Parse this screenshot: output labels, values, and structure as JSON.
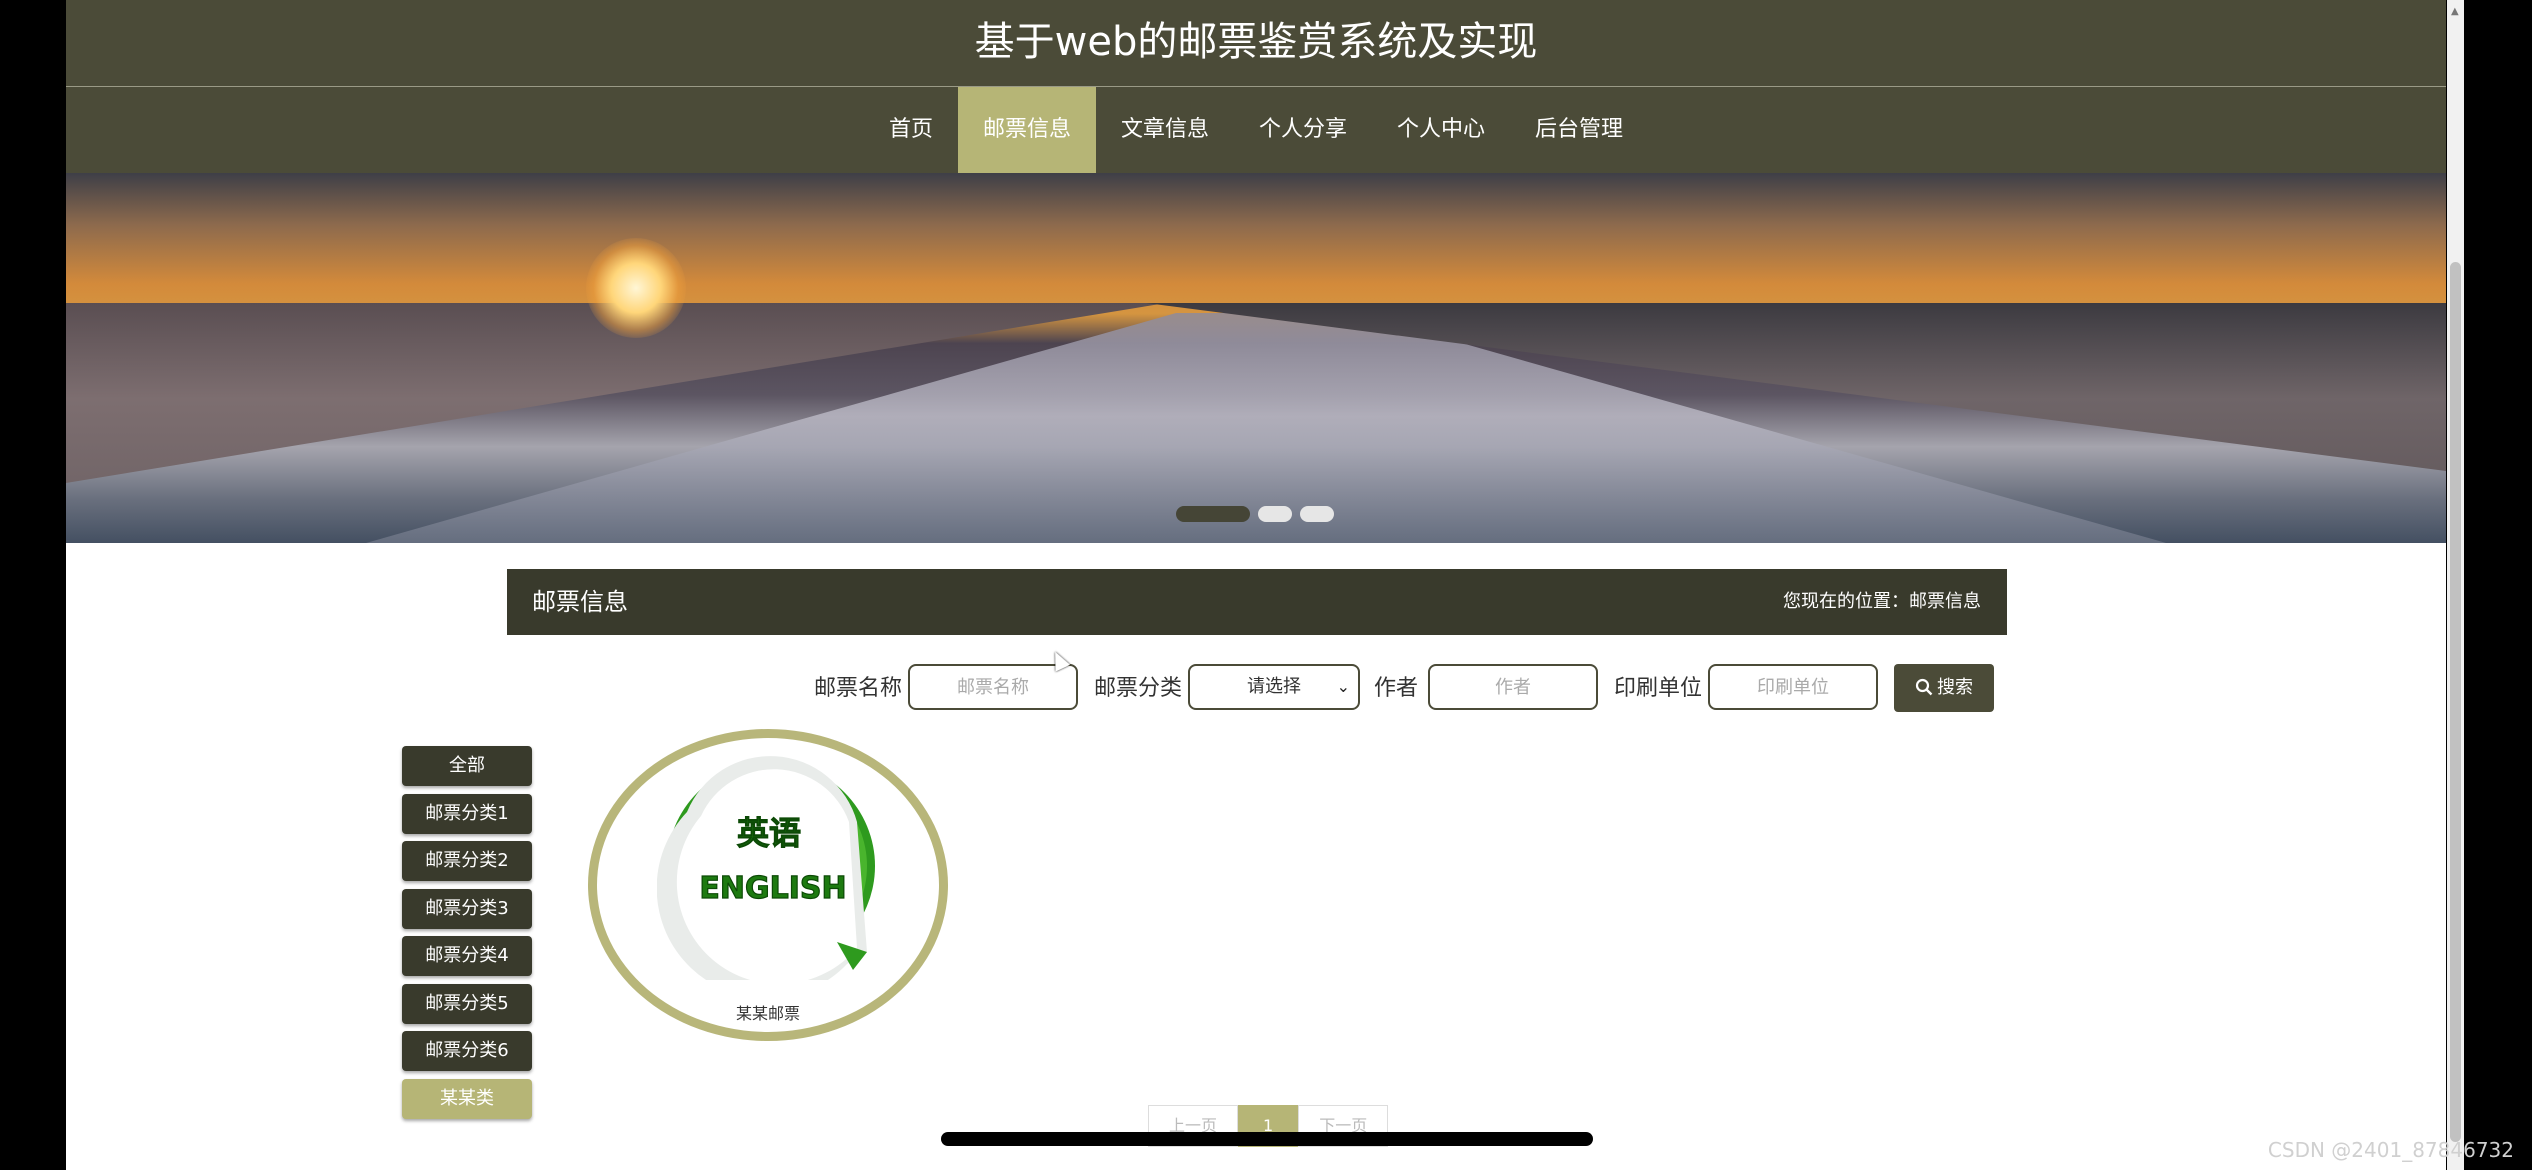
{
  "header": {
    "title": "基于web的邮票鉴赏系统及实现"
  },
  "nav": {
    "items": [
      {
        "label": "首页"
      },
      {
        "label": "邮票信息"
      },
      {
        "label": "文章信息"
      },
      {
        "label": "个人分享"
      },
      {
        "label": "个人中心"
      },
      {
        "label": "后台管理"
      }
    ],
    "active": "邮票信息"
  },
  "banner": {
    "slides": 3,
    "active_slide": 1
  },
  "section": {
    "title": "邮票信息",
    "breadcrumb": "您现在的位置：邮票信息"
  },
  "search": {
    "name_label": "邮票名称",
    "name_placeholder": "邮票名称",
    "category_label": "邮票分类",
    "category_selected": "请选择",
    "author_label": "作者",
    "author_placeholder": "作者",
    "printer_label": "印刷单位",
    "printer_placeholder": "印刷单位",
    "button_label": "搜索"
  },
  "sidebar": {
    "items": [
      {
        "label": "全部"
      },
      {
        "label": "邮票分类1"
      },
      {
        "label": "邮票分类2"
      },
      {
        "label": "邮票分类3"
      },
      {
        "label": "邮票分类4"
      },
      {
        "label": "邮票分类5"
      },
      {
        "label": "邮票分类6"
      },
      {
        "label": "某某类"
      }
    ],
    "active": "某某类"
  },
  "products": [
    {
      "name": "某某邮票",
      "image_text_top": "英语",
      "image_text_bottom": "ENGLISH"
    }
  ],
  "pagination": {
    "prev": "上一页",
    "current": "1",
    "next": "下一页"
  },
  "watermark": "CSDN @2401_87846732",
  "colors": {
    "primary": "#4b4b38",
    "accent": "#b6b576",
    "dark": "#393a2c"
  }
}
